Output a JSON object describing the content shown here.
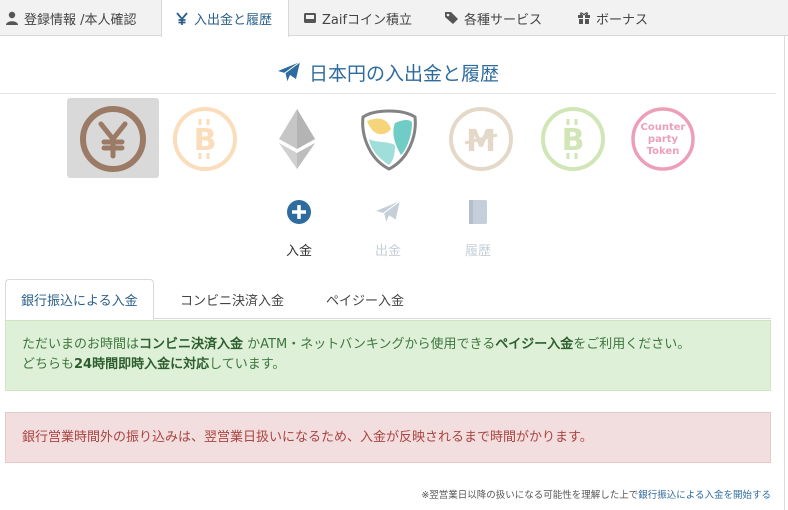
{
  "topnav": {
    "tabs": [
      {
        "label": "登録情報 /本人確認",
        "icon": "user-icon"
      },
      {
        "label": "入出金と履歴",
        "icon": "yen-icon"
      },
      {
        "label": "Zaifコイン積立",
        "icon": "inbox-icon"
      },
      {
        "label": "各種サービス",
        "icon": "tags-icon"
      },
      {
        "label": "ボーナス",
        "icon": "gift-icon"
      }
    ]
  },
  "page": {
    "title": "日本円の入出金と履歴",
    "title_icon": "paper-plane-icon"
  },
  "currencies": [
    {
      "name": "JPY",
      "icon": "yen-coin-icon",
      "selected": true,
      "color": "#9b7b66"
    },
    {
      "name": "BTC",
      "icon": "bitcoin-icon",
      "color": "#f7b46a"
    },
    {
      "name": "ETH",
      "icon": "ethereum-icon",
      "color": "#888888"
    },
    {
      "name": "XEM",
      "icon": "nem-icon",
      "color": "#41bdb3"
    },
    {
      "name": "MONA",
      "icon": "monacoin-icon",
      "color": "#c5ad88"
    },
    {
      "name": "BCH",
      "icon": "bitcoin-cash-icon",
      "color": "#8bc34a"
    },
    {
      "name": "Counterparty Token",
      "icon": "counterparty-token-icon",
      "color": "#e87fa0",
      "lines": [
        "Counter",
        "party",
        "Token"
      ]
    }
  ],
  "actions": [
    {
      "label": "入金",
      "icon": "plus-circle-icon",
      "active": true
    },
    {
      "label": "出金",
      "icon": "send-icon",
      "active": false
    },
    {
      "label": "履歴",
      "icon": "book-icon",
      "active": false
    }
  ],
  "subtabs": [
    {
      "label": "銀行振込による入金"
    },
    {
      "label": "コンビニ決済入金"
    },
    {
      "label": "ペイジー入金"
    }
  ],
  "notice_success": {
    "p1": "ただいまのお時間は",
    "b1": "コンビニ決済入金",
    "p2": " かATM・ネットバンキングから使用できる",
    "b2": "ペイジー入金",
    "p3": "をご利用ください。",
    "p4": "どちらも",
    "b3": "24時間即時入金に対応",
    "p5": "しています。"
  },
  "notice_danger": {
    "text": "銀行営業時間外の振り込みは、翌営業日扱いになるため、入金が反映されるまで時間がかります。"
  },
  "footnote": {
    "text": "※翌営業日以降の扱いになる可能性を理解した上で",
    "link": "銀行振込による入金を開始する"
  },
  "colors": {
    "accent": "#2e6b9e",
    "success_bg": "#dff0d8",
    "danger_bg": "#f2dede"
  }
}
